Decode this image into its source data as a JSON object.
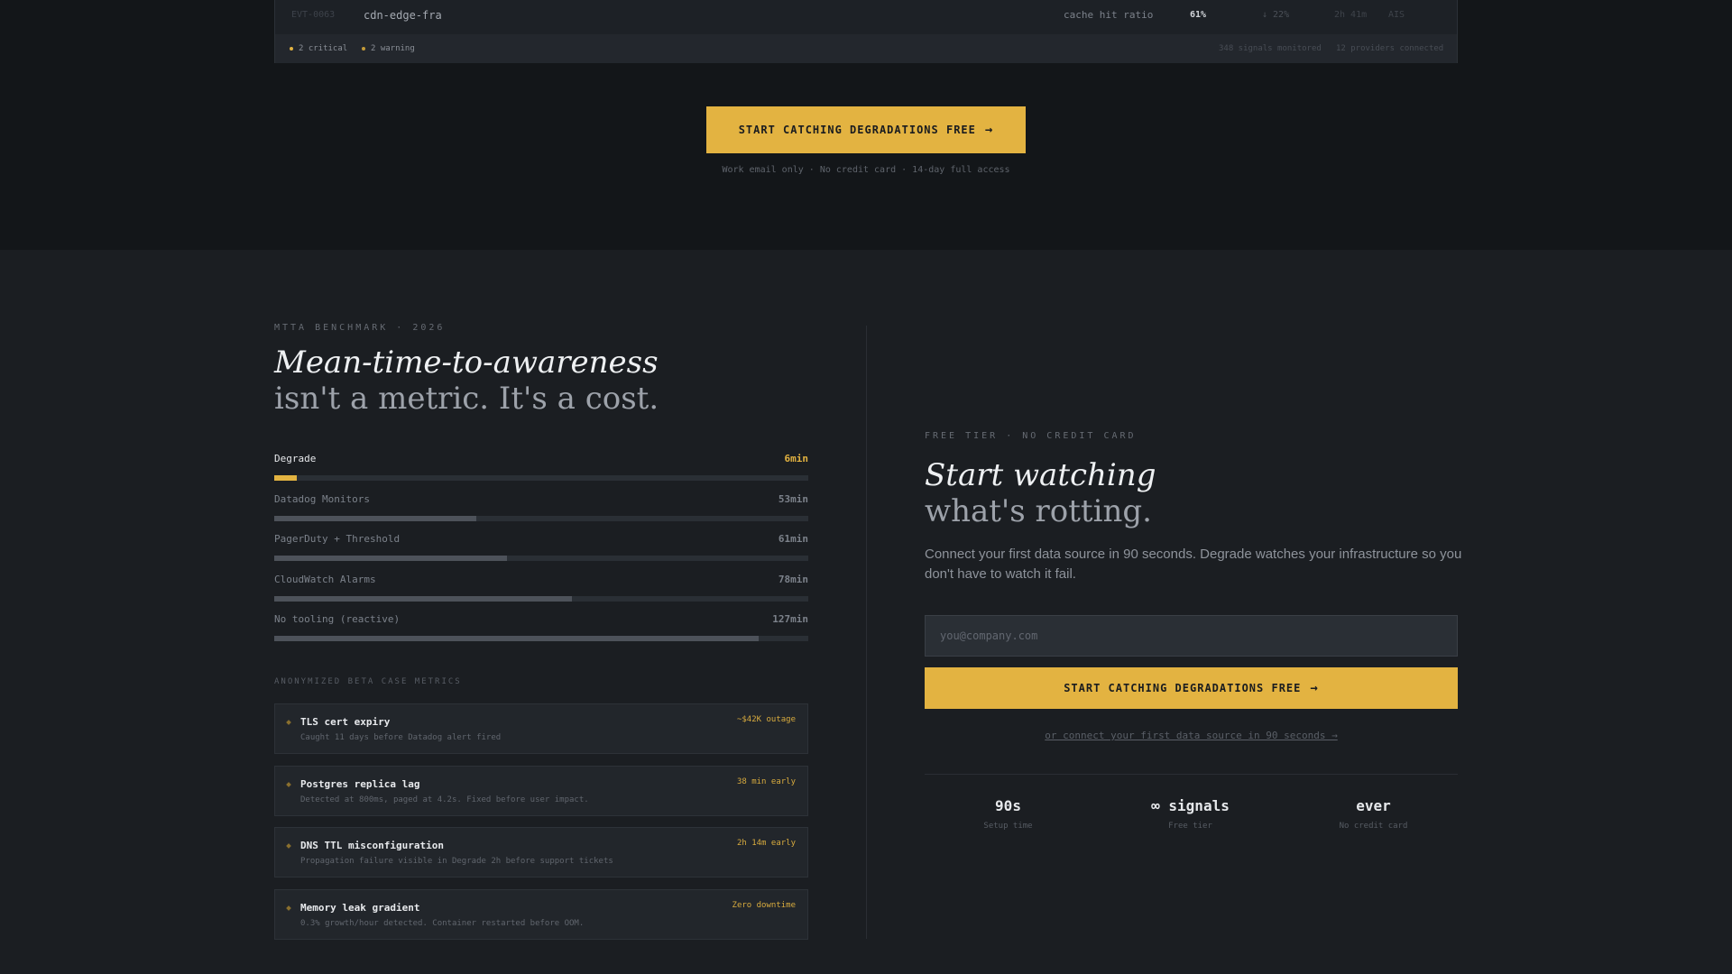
{
  "event_panel": {
    "row": {
      "id": "EVT-0063",
      "service": "cdn-edge-fra",
      "metric": "cache hit ratio",
      "value": "61%",
      "delta": "↓ 22%",
      "duration": "2h 41m",
      "tag": "AIS"
    },
    "footer": {
      "critical": "2 critical",
      "warning": "2 warning",
      "signals": "348 signals monitored",
      "providers": "12 providers connected"
    }
  },
  "hero_cta": {
    "label": "START CATCHING DEGRADATIONS FREE",
    "subtext": "Work email only · No credit card · 14-day full access"
  },
  "benchmark": {
    "eyebrow": "MTTA BENCHMARK · 2026",
    "headline_italic": "Mean-time-to-awareness",
    "headline_plain": "isn't a metric. It's a cost.",
    "max_minutes": 140,
    "rows": [
      {
        "label": "Degrade",
        "value_label": "6min",
        "minutes": 6,
        "highlight": true
      },
      {
        "label": "Datadog Monitors",
        "value_label": "53min",
        "minutes": 53,
        "highlight": false
      },
      {
        "label": "PagerDuty + Threshold",
        "value_label": "61min",
        "minutes": 61,
        "highlight": false
      },
      {
        "label": "CloudWatch Alarms",
        "value_label": "78min",
        "minutes": 78,
        "highlight": false
      },
      {
        "label": "No tooling (reactive)",
        "value_label": "127min",
        "minutes": 127,
        "highlight": false
      }
    ]
  },
  "cases": {
    "eyebrow": "ANONYMIZED BETA CASE METRICS",
    "items": [
      {
        "title": "TLS cert expiry",
        "description": "Caught 11 days before Datadog alert fired",
        "badge": "~$42K outage"
      },
      {
        "title": "Postgres replica lag",
        "description": "Detected at 800ms, paged at 4.2s. Fixed before user impact.",
        "badge": "38 min early"
      },
      {
        "title": "DNS TTL misconfiguration",
        "description": "Propagation failure visible in Degrade 2h before support tickets",
        "badge": "2h 14m early"
      },
      {
        "title": "Memory leak gradient",
        "description": "0.3% growth/hour detected. Container restarted before OOM.",
        "badge": "Zero downtime"
      }
    ]
  },
  "signup": {
    "eyebrow": "FREE TIER · NO CREDIT CARD",
    "headline_italic": "Start watching",
    "headline_plain": "what's rotting.",
    "lead": "Connect your first data source in 90 seconds. Degrade watches your infrastructure so you don't have to watch it fail.",
    "email_placeholder": "you@company.com",
    "cta_label": "START CATCHING DEGRADATIONS FREE",
    "alt_link": "or connect your first data source in 90 seconds →",
    "stats": [
      {
        "value": "90s",
        "label": "Setup time"
      },
      {
        "value": "∞ signals",
        "label": "Free tier"
      },
      {
        "value": "ever",
        "label": "No credit card"
      }
    ]
  },
  "colors": {
    "accent": "#e3b341",
    "background": "#1b1e22",
    "top_band": "#131619"
  }
}
